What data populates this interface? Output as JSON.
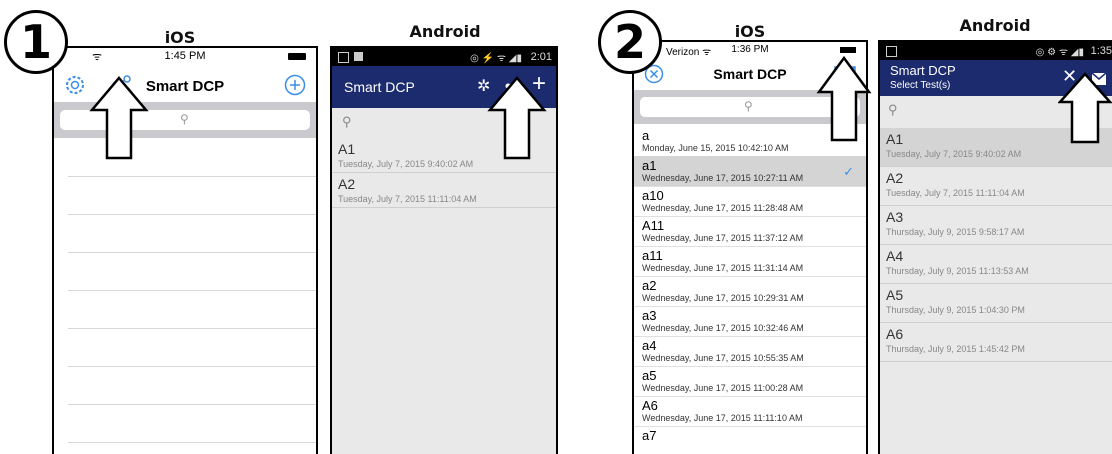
{
  "step1": {
    "number": "1",
    "ios_label": "iOS",
    "android_label": "Android",
    "ios": {
      "time": "1:45 PM",
      "title": "Smart DCP"
    },
    "android": {
      "status_time": "2:01",
      "title": "Smart DCP",
      "items": [
        {
          "name": "A1",
          "date": "Tuesday, July 7, 2015 9:40:02 AM"
        },
        {
          "name": "A2",
          "date": "Tuesday, July 7, 2015 11:11:04 AM"
        }
      ]
    }
  },
  "step2": {
    "number": "2",
    "ios_label": "iOS",
    "android_label": "Android",
    "ios": {
      "carrier": "Verizon",
      "time": "1:36 PM",
      "title": "Smart DCP",
      "items": [
        {
          "name": "a",
          "date": "Monday, June 15, 2015 10:42:10 AM",
          "selected": false
        },
        {
          "name": "a1",
          "date": "Wednesday, June 17, 2015 10:27:11 AM",
          "selected": true
        },
        {
          "name": "a10",
          "date": "Wednesday, June 17, 2015 11:28:48 AM",
          "selected": false
        },
        {
          "name": "A11",
          "date": "Wednesday, June 17, 2015 11:37:12 AM",
          "selected": false
        },
        {
          "name": "a11",
          "date": "Wednesday, June 17, 2015 11:31:14 AM",
          "selected": false
        },
        {
          "name": "a2",
          "date": "Wednesday, June 17, 2015 10:29:31 AM",
          "selected": false
        },
        {
          "name": "a3",
          "date": "Wednesday, June 17, 2015 10:32:46 AM",
          "selected": false
        },
        {
          "name": "a4",
          "date": "Wednesday, June 17, 2015 10:55:35 AM",
          "selected": false
        },
        {
          "name": "a5",
          "date": "Wednesday, June 17, 2015 11:00:28 AM",
          "selected": false
        },
        {
          "name": "A6",
          "date": "Wednesday, June 17, 2015 11:11:10 AM",
          "selected": false
        },
        {
          "name": "a7",
          "date": "",
          "selected": false
        }
      ]
    },
    "android": {
      "status_time": "1:35",
      "title": "Smart DCP",
      "subtitle": "Select Test(s)",
      "items": [
        {
          "name": "A1",
          "date": "Tuesday, July 7, 2015 9:40:02 AM",
          "selected": true
        },
        {
          "name": "A2",
          "date": "Tuesday, July 7, 2015 11:11:04 AM",
          "selected": false
        },
        {
          "name": "A3",
          "date": "Thursday, July 9, 2015 9:58:17 AM",
          "selected": false
        },
        {
          "name": "A4",
          "date": "Thursday, July 9, 2015 11:13:53 AM",
          "selected": false
        },
        {
          "name": "A5",
          "date": "Thursday, July 9, 2015 1:04:30 PM",
          "selected": false
        },
        {
          "name": "A6",
          "date": "Thursday, July 9, 2015 1:45:42 PM",
          "selected": false
        }
      ]
    }
  },
  "colors": {
    "ios_accent": "#3a8ee6",
    "android_bar": "#1c2a6e",
    "selected_row": "#d4d4d4"
  }
}
